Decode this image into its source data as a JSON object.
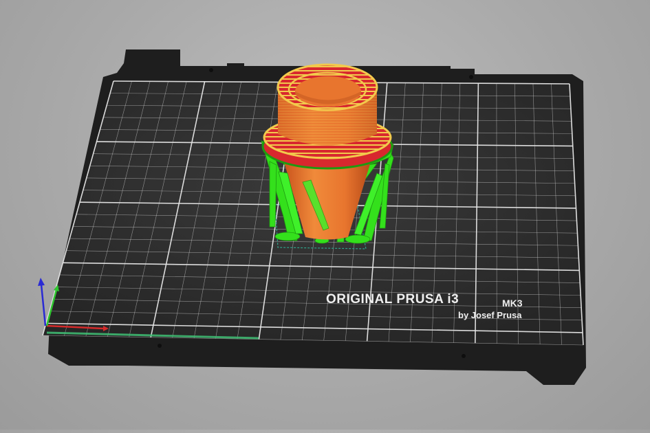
{
  "bed": {
    "brand_line": "ORIGINAL PRUSA i3",
    "model_suffix": "MK3",
    "maker_line": "by Josef Prusa"
  },
  "colors": {
    "background": "#a9a9a9",
    "bed_surface": "#2b2b2b",
    "bed_frame": "#1c1c1c",
    "grid_line": "#e6e6e6",
    "perimeter": "#e8752e",
    "top_solid_infill": "#d8282e",
    "external_perimeter": "#f2c94c",
    "support_material": "#34e01c",
    "axis_x": "#d42a2a",
    "axis_y": "#2ec52e",
    "axis_z": "#2a2ad4"
  },
  "axes": {
    "x": "x-axis",
    "y": "y-axis",
    "z": "z-axis"
  },
  "icons": [
    "axis-gizmo-icon"
  ]
}
